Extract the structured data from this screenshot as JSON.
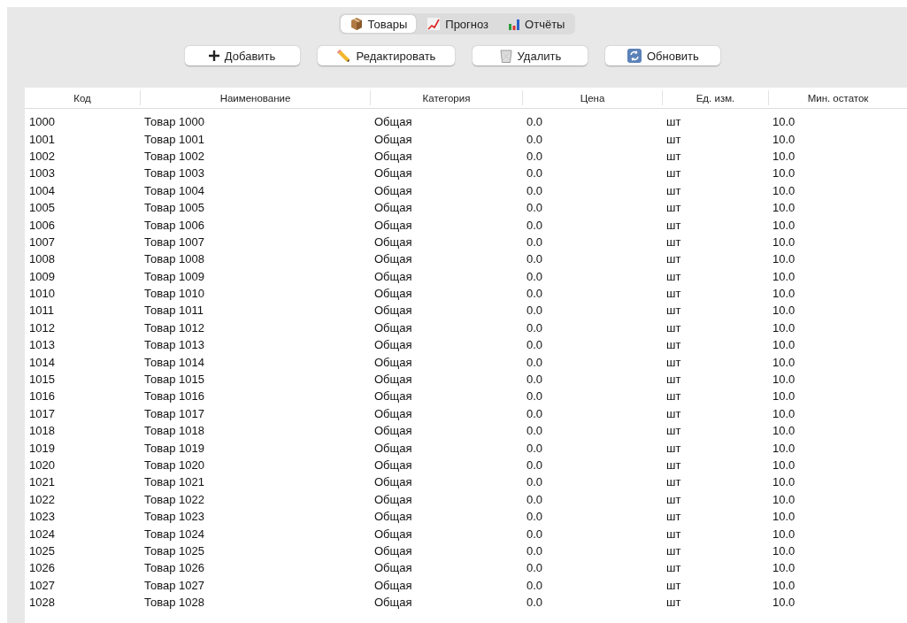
{
  "tabs": [
    {
      "label": "Товары",
      "kind": "box",
      "selected": true
    },
    {
      "label": "Прогноз",
      "kind": "trend",
      "selected": false
    },
    {
      "label": "Отчёты",
      "kind": "bars",
      "selected": false
    }
  ],
  "toolbar": [
    {
      "label": "Добавить",
      "kind": "plus"
    },
    {
      "label": "Редактировать",
      "kind": "pencil"
    },
    {
      "label": "Удалить",
      "kind": "trash"
    },
    {
      "label": "Обновить",
      "kind": "refresh"
    }
  ],
  "table": {
    "columns": [
      "Код",
      "Наименование",
      "Категория",
      "Цена",
      "Ед. изм.",
      "Мин. остаток"
    ],
    "rows": [
      [
        "1000",
        "Товар 1000",
        "Общая",
        "0.0",
        "шт",
        "10.0"
      ],
      [
        "1001",
        "Товар 1001",
        "Общая",
        "0.0",
        "шт",
        "10.0"
      ],
      [
        "1002",
        "Товар 1002",
        "Общая",
        "0.0",
        "шт",
        "10.0"
      ],
      [
        "1003",
        "Товар 1003",
        "Общая",
        "0.0",
        "шт",
        "10.0"
      ],
      [
        "1004",
        "Товар 1004",
        "Общая",
        "0.0",
        "шт",
        "10.0"
      ],
      [
        "1005",
        "Товар 1005",
        "Общая",
        "0.0",
        "шт",
        "10.0"
      ],
      [
        "1006",
        "Товар 1006",
        "Общая",
        "0.0",
        "шт",
        "10.0"
      ],
      [
        "1007",
        "Товар 1007",
        "Общая",
        "0.0",
        "шт",
        "10.0"
      ],
      [
        "1008",
        "Товар 1008",
        "Общая",
        "0.0",
        "шт",
        "10.0"
      ],
      [
        "1009",
        "Товар 1009",
        "Общая",
        "0.0",
        "шт",
        "10.0"
      ],
      [
        "1010",
        "Товар 1010",
        "Общая",
        "0.0",
        "шт",
        "10.0"
      ],
      [
        "1011",
        "Товар 1011",
        "Общая",
        "0.0",
        "шт",
        "10.0"
      ],
      [
        "1012",
        "Товар 1012",
        "Общая",
        "0.0",
        "шт",
        "10.0"
      ],
      [
        "1013",
        "Товар 1013",
        "Общая",
        "0.0",
        "шт",
        "10.0"
      ],
      [
        "1014",
        "Товар 1014",
        "Общая",
        "0.0",
        "шт",
        "10.0"
      ],
      [
        "1015",
        "Товар 1015",
        "Общая",
        "0.0",
        "шт",
        "10.0"
      ],
      [
        "1016",
        "Товар 1016",
        "Общая",
        "0.0",
        "шт",
        "10.0"
      ],
      [
        "1017",
        "Товар 1017",
        "Общая",
        "0.0",
        "шт",
        "10.0"
      ],
      [
        "1018",
        "Товар 1018",
        "Общая",
        "0.0",
        "шт",
        "10.0"
      ],
      [
        "1019",
        "Товар 1019",
        "Общая",
        "0.0",
        "шт",
        "10.0"
      ],
      [
        "1020",
        "Товар 1020",
        "Общая",
        "0.0",
        "шт",
        "10.0"
      ],
      [
        "1021",
        "Товар 1021",
        "Общая",
        "0.0",
        "шт",
        "10.0"
      ],
      [
        "1022",
        "Товар 1022",
        "Общая",
        "0.0",
        "шт",
        "10.0"
      ],
      [
        "1023",
        "Товар 1023",
        "Общая",
        "0.0",
        "шт",
        "10.0"
      ],
      [
        "1024",
        "Товар 1024",
        "Общая",
        "0.0",
        "шт",
        "10.0"
      ],
      [
        "1025",
        "Товар 1025",
        "Общая",
        "0.0",
        "шт",
        "10.0"
      ],
      [
        "1026",
        "Товар 1026",
        "Общая",
        "0.0",
        "шт",
        "10.0"
      ],
      [
        "1027",
        "Товар 1027",
        "Общая",
        "0.0",
        "шт",
        "10.0"
      ],
      [
        "1028",
        "Товар 1028",
        "Общая",
        "0.0",
        "шт",
        "10.0"
      ]
    ]
  }
}
